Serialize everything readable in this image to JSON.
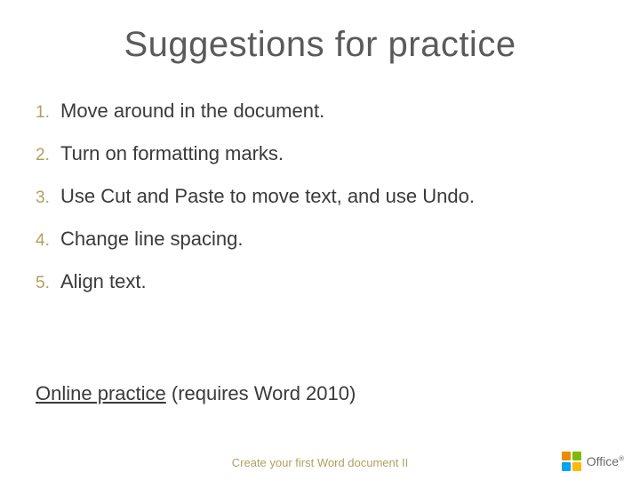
{
  "title": "Suggestions for practice",
  "items": [
    {
      "n": "1.",
      "t": "Move around in the document."
    },
    {
      "n": "2.",
      "t": "Turn on formatting marks."
    },
    {
      "n": "3.",
      "t": "Use Cut and Paste to move text, and use Undo."
    },
    {
      "n": "4.",
      "t": "Change line spacing."
    },
    {
      "n": "5.",
      "t": "Align text."
    }
  ],
  "link": {
    "label": "Online practice",
    "note": " (requires Word 2010)"
  },
  "footer": "Create your first Word document II",
  "logo": {
    "brand": "Office",
    "reg": "®"
  }
}
